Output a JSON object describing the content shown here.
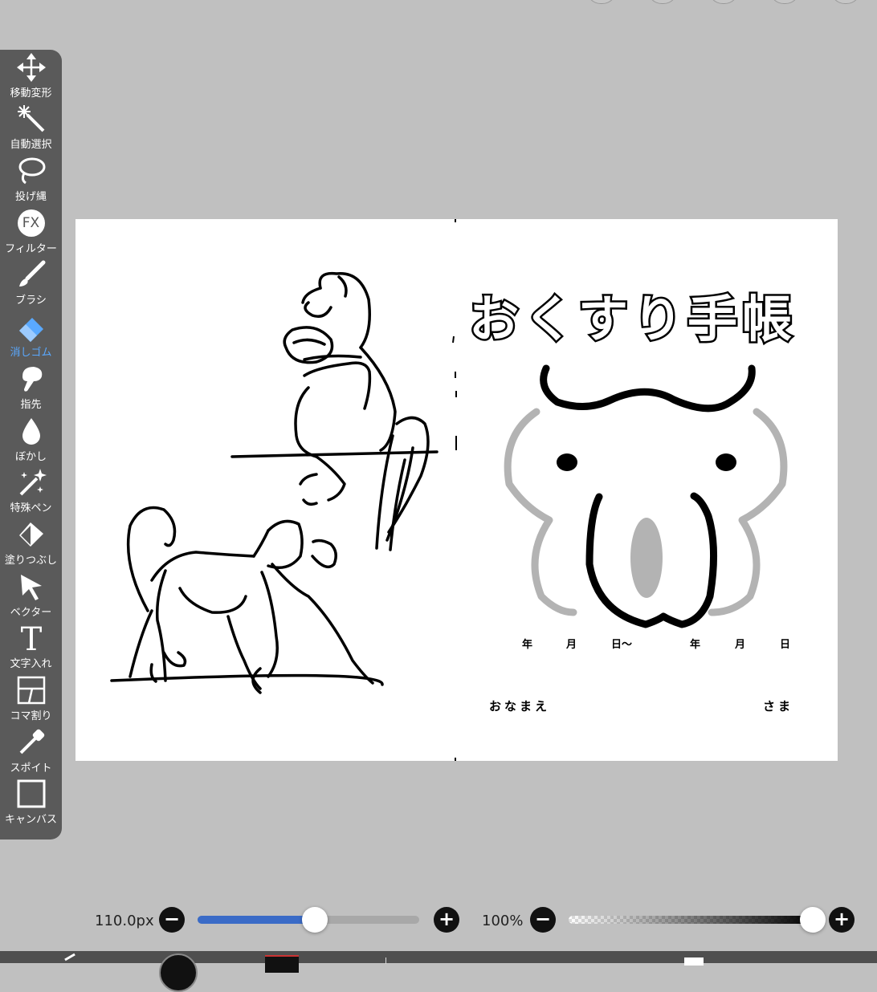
{
  "toolbar": {
    "items": [
      {
        "label": "移動変形",
        "icon": "move-arrows-icon"
      },
      {
        "label": "自動選択",
        "icon": "magic-wand-icon"
      },
      {
        "label": "投げ縄",
        "icon": "lasso-icon"
      },
      {
        "label": "フィルター",
        "icon": "fx-icon"
      },
      {
        "label": "ブラシ",
        "icon": "brush-icon"
      },
      {
        "label": "消しゴム",
        "icon": "eraser-icon"
      },
      {
        "label": "指先",
        "icon": "finger-icon"
      },
      {
        "label": "ぼかし",
        "icon": "drop-icon"
      },
      {
        "label": "特殊ペン",
        "icon": "sparkle-pen-icon"
      },
      {
        "label": "塗りつぶし",
        "icon": "fill-bucket-icon"
      },
      {
        "label": "ベクター",
        "icon": "cursor-arrow-icon"
      },
      {
        "label": "文字入れ",
        "icon": "text-t-icon"
      },
      {
        "label": "コマ割り",
        "icon": "panel-grid-icon"
      },
      {
        "label": "スポイト",
        "icon": "eyedropper-icon"
      },
      {
        "label": "キャンバス",
        "icon": "canvas-square-icon"
      }
    ],
    "active": "消しゴム",
    "active_color": "#5aa9ff"
  },
  "canvas": {
    "fx_text": "FX",
    "title": "おくすり手帳",
    "date_line": {
      "nen1": "年",
      "tsuki1": "月",
      "hi1": "日～",
      "nen2": "年",
      "tsuki2": "月",
      "hi2": "日"
    },
    "name_label": "おなまえ",
    "sama_label": "さま"
  },
  "brush_size": {
    "readout": "110.0px",
    "minus": "−",
    "plus": "+",
    "level": 0.53,
    "fill_color": "#3a6bc7"
  },
  "opacity": {
    "readout": "100%",
    "minus": "−",
    "plus": "+",
    "level": 1.0
  },
  "colors": {
    "background": "#c0c0c0",
    "toolbar": "#5a5a5a",
    "page": "#ffffff"
  }
}
